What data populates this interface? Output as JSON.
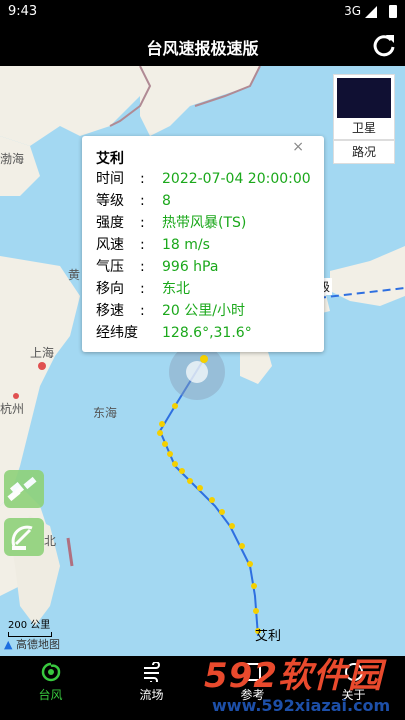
{
  "statusbar": {
    "time": "9:43",
    "network": "3G"
  },
  "header": {
    "title": "台风速报极速版"
  },
  "map": {
    "labels": {
      "bohai": "渤海",
      "huang": "黄",
      "shanghai": "上海",
      "hangzhou": "杭州",
      "donghai": "东海",
      "taibei": "北",
      "ji": "级",
      "typhoon_label": "艾利"
    },
    "scale_text": "200 公里",
    "provider": "高德地图"
  },
  "layers": {
    "satellite_label": "卫星",
    "road_label": "路况"
  },
  "popup": {
    "name": "艾利",
    "close_glyph": "×",
    "rows": [
      {
        "label": "时间",
        "value": "2022-07-04 20:00:00"
      },
      {
        "label": "等级",
        "value": "8"
      },
      {
        "label": "强度",
        "value": "热带风暴(TS)"
      },
      {
        "label": "风速",
        "value": "18 m/s"
      },
      {
        "label": "气压",
        "value": "996 hPa"
      },
      {
        "label": "移向",
        "value": "东北"
      },
      {
        "label": "移速",
        "value": "20 公里/小时"
      },
      {
        "label": "经纬度",
        "value": "128.6°,31.6°"
      }
    ],
    "colon": ":"
  },
  "tabs": [
    {
      "label": "台风",
      "icon": "typhoon-icon",
      "active": true
    },
    {
      "label": "流场",
      "icon": "wind-icon",
      "active": false
    },
    {
      "label": "参考",
      "icon": "reference-icon",
      "active": false
    },
    {
      "label": "关于",
      "icon": "about-icon",
      "active": false
    }
  ],
  "watermark": {
    "brand": "592软件园",
    "url": "www.592xiazai.com"
  },
  "colors": {
    "accent_green": "#39c93f",
    "value_green": "#1ba81b",
    "track_yellow": "#f5d000",
    "track_blue": "#2e6fe0"
  }
}
